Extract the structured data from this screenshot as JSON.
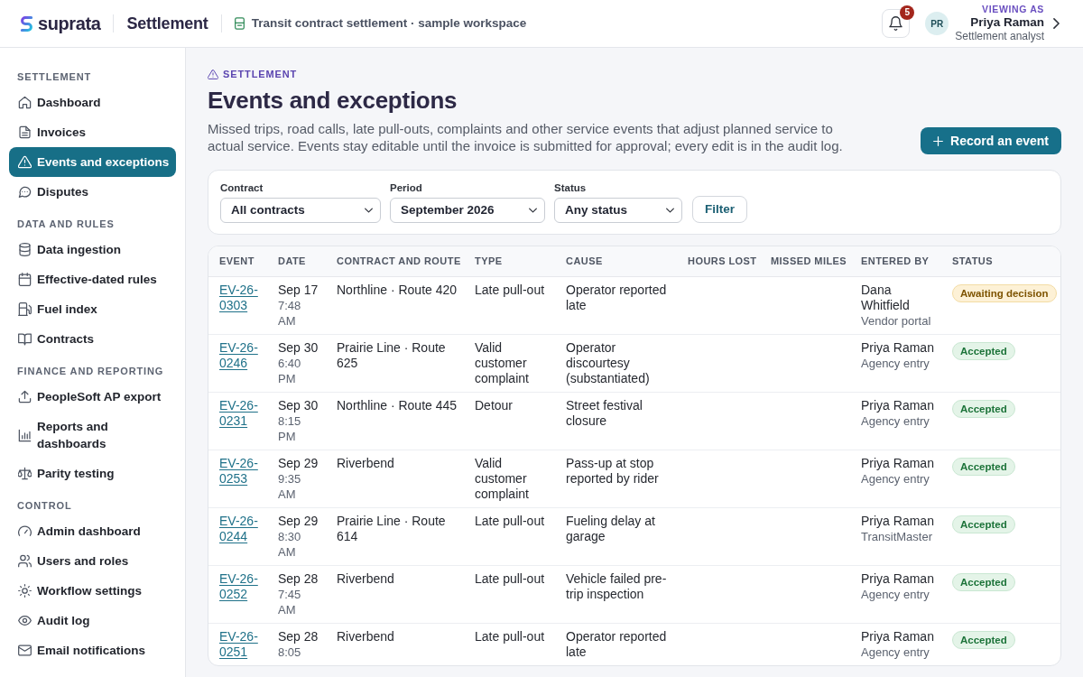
{
  "header": {
    "brand": "suprata",
    "app_name": "Settlement",
    "workspace": "Transit contract settlement · sample workspace",
    "notifications": {
      "count": "5"
    },
    "user": {
      "initials": "PR",
      "caption": "VIEWING AS",
      "name": "Priya Raman",
      "role": "Settlement analyst"
    }
  },
  "sidebar": {
    "sections": [
      {
        "title": "SETTLEMENT",
        "items": [
          {
            "label": "Dashboard",
            "selected": false
          },
          {
            "label": "Invoices",
            "selected": false
          },
          {
            "label": "Events and exceptions",
            "selected": true
          },
          {
            "label": "Disputes",
            "selected": false
          }
        ]
      },
      {
        "title": "DATA AND RULES",
        "items": [
          {
            "label": "Data ingestion",
            "selected": false
          },
          {
            "label": "Effective-dated rules",
            "selected": false
          },
          {
            "label": "Fuel index",
            "selected": false
          },
          {
            "label": "Contracts",
            "selected": false
          }
        ]
      },
      {
        "title": "FINANCE AND REPORTING",
        "items": [
          {
            "label": "PeopleSoft AP export",
            "selected": false
          },
          {
            "label": "Reports and dashboards",
            "selected": false
          },
          {
            "label": "Parity testing",
            "selected": false
          }
        ]
      },
      {
        "title": "CONTROL",
        "items": [
          {
            "label": "Admin dashboard",
            "selected": false
          },
          {
            "label": "Users and roles",
            "selected": false
          },
          {
            "label": "Workflow settings",
            "selected": false
          },
          {
            "label": "Audit log",
            "selected": false
          },
          {
            "label": "Email notifications",
            "selected": false
          }
        ]
      }
    ]
  },
  "page": {
    "breadcrumb": "SETTLEMENT",
    "title": "Events and exceptions",
    "description": "Missed trips, road calls, late pull-outs, complaints and other service events that adjust planned service to actual service. Events stay editable until the invoice is submitted for approval; every edit is in the audit log.",
    "primary_button": "Record an event"
  },
  "filters": {
    "fields": [
      {
        "label": "Contract",
        "value": "All contracts"
      },
      {
        "label": "Period",
        "value": "September 2026"
      },
      {
        "label": "Status",
        "value": "Any status"
      }
    ],
    "button": "Filter"
  },
  "table": {
    "columns": [
      "EVENT",
      "DATE",
      "CONTRACT AND ROUTE",
      "TYPE",
      "CAUSE",
      "HOURS LOST",
      "MISSED MILES",
      "ENTERED BY",
      "STATUS"
    ],
    "rows": [
      {
        "event": "EV-26-0303",
        "date": "Sep 17",
        "time": "7:48 AM",
        "contract_route": "Northline · Route 420",
        "type": "Late pull-out",
        "cause": "Operator reported late",
        "entered_by": "Dana Whitfield",
        "source": "Vendor portal",
        "status": {
          "label": "Awaiting decision",
          "kind": "pending"
        }
      },
      {
        "event": "EV-26-0246",
        "date": "Sep 30",
        "time": "6:40 PM",
        "contract_route": "Prairie Line · Route 625",
        "type": "Valid customer complaint",
        "cause": "Operator discourtesy (substantiated)",
        "entered_by": "Priya Raman",
        "source": "Agency entry",
        "status": {
          "label": "Accepted",
          "kind": "accepted"
        }
      },
      {
        "event": "EV-26-0231",
        "date": "Sep 30",
        "time": "8:15 PM",
        "contract_route": "Northline · Route 445",
        "type": "Detour",
        "cause": "Street festival closure",
        "entered_by": "Priya Raman",
        "source": "Agency entry",
        "status": {
          "label": "Accepted",
          "kind": "accepted"
        }
      },
      {
        "event": "EV-26-0253",
        "date": "Sep 29",
        "time": "9:35 AM",
        "contract_route": "Riverbend",
        "type": "Valid customer complaint",
        "cause": "Pass-up at stop reported by rider",
        "entered_by": "Priya Raman",
        "source": "Agency entry",
        "status": {
          "label": "Accepted",
          "kind": "accepted"
        }
      },
      {
        "event": "EV-26-0244",
        "date": "Sep 29",
        "time": "8:30 AM",
        "contract_route": "Prairie Line · Route 614",
        "type": "Late pull-out",
        "cause": "Fueling delay at garage",
        "entered_by": "Priya Raman",
        "source": "TransitMaster",
        "status": {
          "label": "Accepted",
          "kind": "accepted"
        }
      },
      {
        "event": "EV-26-0252",
        "date": "Sep 28",
        "time": "7:45 AM",
        "contract_route": "Riverbend",
        "type": "Late pull-out",
        "cause": "Vehicle failed pre-trip inspection",
        "entered_by": "Priya Raman",
        "source": "Agency entry",
        "status": {
          "label": "Accepted",
          "kind": "accepted"
        }
      },
      {
        "event": "EV-26-0251",
        "date": "Sep 28",
        "time": "8:05",
        "contract_route": "Riverbend",
        "type": "Late pull-out",
        "cause": "Operator reported late",
        "entered_by": "Priya Raman",
        "source": "Agency entry",
        "status": {
          "label": "Accepted",
          "kind": "accepted"
        }
      }
    ]
  }
}
